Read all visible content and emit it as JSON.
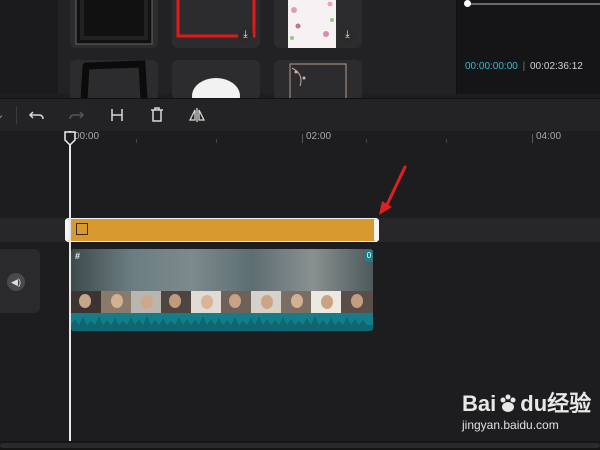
{
  "preview": {
    "current_time": "00:00:00:00",
    "separator": "|",
    "total_time": "00:02:36:12"
  },
  "ruler": {
    "labels": [
      "00:00",
      "02:00",
      "04:00"
    ]
  },
  "sticker_track": {
    "color": "#d89a2e"
  },
  "video_track": {
    "badge_left": "#",
    "badge_right": "0"
  },
  "watermark": {
    "brand": "Bai",
    "brand_tail": "经验",
    "url": "jingyan.baidu.com"
  },
  "colors": {
    "accent_time": "#2bbfd6",
    "waveform": "#1a8f9a",
    "arrow": "#e02020"
  }
}
